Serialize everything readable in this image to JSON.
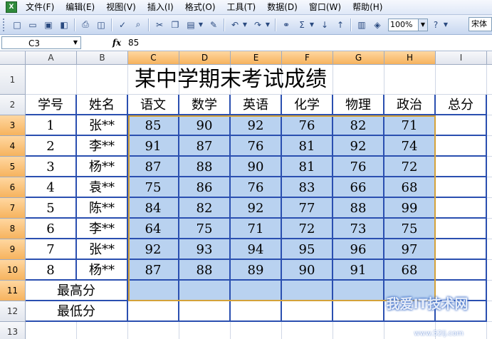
{
  "menu": [
    "文件(F)",
    "编辑(E)",
    "视图(V)",
    "插入(I)",
    "格式(O)",
    "工具(T)",
    "数据(D)",
    "窗口(W)",
    "帮助(H)"
  ],
  "toolbar": {
    "zoom": "100%",
    "font": "宋体"
  },
  "formula": {
    "name_box": "C3",
    "fx": "fx",
    "value": "85"
  },
  "columns": [
    "A",
    "B",
    "C",
    "D",
    "E",
    "F",
    "G",
    "H",
    "I"
  ],
  "rows": [
    "1",
    "2",
    "3",
    "4",
    "5",
    "6",
    "7",
    "8",
    "9",
    "10",
    "11",
    "12",
    "13"
  ],
  "sheet": {
    "title": "某中学期末考试成绩",
    "headers": [
      "学号",
      "姓名",
      "语文",
      "数学",
      "英语",
      "化学",
      "物理",
      "政治",
      "总分"
    ],
    "students": [
      [
        "1",
        "张**",
        "85",
        "90",
        "92",
        "76",
        "82",
        "71"
      ],
      [
        "2",
        "李**",
        "91",
        "87",
        "76",
        "81",
        "92",
        "74"
      ],
      [
        "3",
        "杨**",
        "87",
        "88",
        "90",
        "81",
        "76",
        "72"
      ],
      [
        "4",
        "袁**",
        "75",
        "86",
        "76",
        "83",
        "66",
        "68"
      ],
      [
        "5",
        "陈**",
        "84",
        "82",
        "92",
        "77",
        "88",
        "99"
      ],
      [
        "6",
        "李**",
        "64",
        "75",
        "71",
        "72",
        "73",
        "75"
      ],
      [
        "7",
        "张**",
        "92",
        "93",
        "94",
        "95",
        "96",
        "97"
      ],
      [
        "8",
        "杨**",
        "87",
        "88",
        "89",
        "90",
        "91",
        "68"
      ]
    ],
    "max_label": "最高分",
    "min_label": "最低分"
  },
  "watermark": {
    "text": "我爱IT技术网",
    "url": "www.52ij.com"
  }
}
